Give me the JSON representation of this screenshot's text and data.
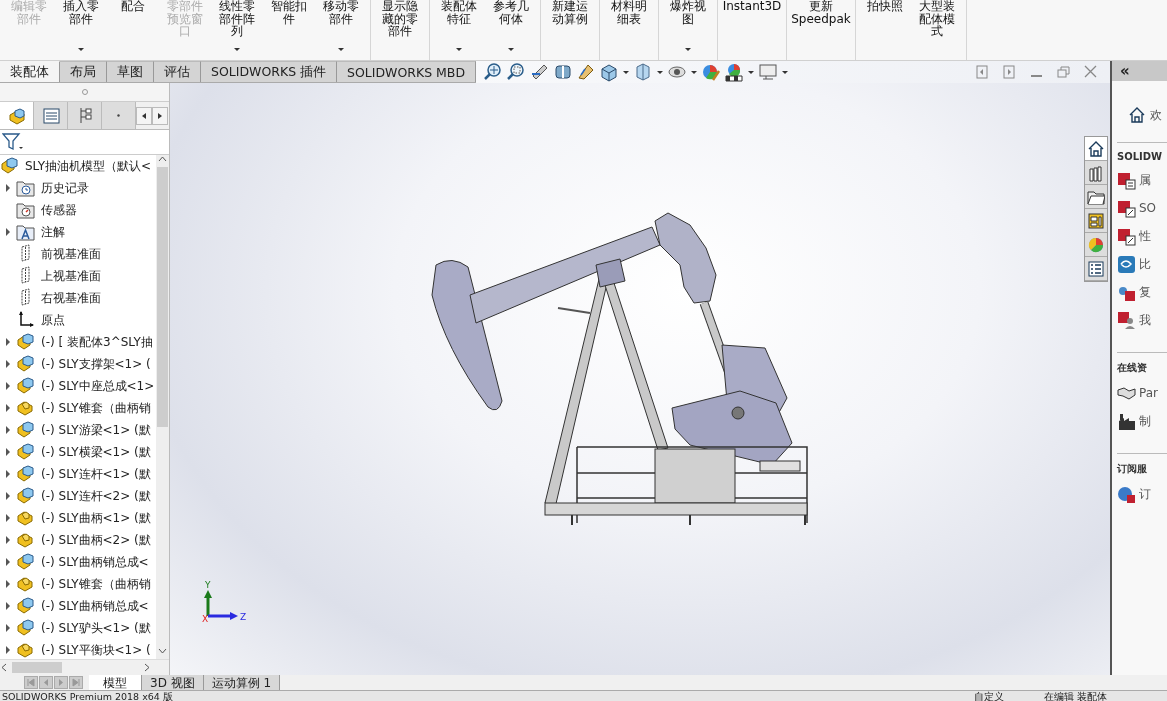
{
  "ribbon": {
    "groups": [
      [
        {
          "label": "编辑零部件",
          "disabled": true,
          "dropdown": false
        },
        {
          "label": "插入零部件",
          "disabled": false,
          "dropdown": true
        },
        {
          "label": "配合",
          "disabled": false,
          "dropdown": false
        },
        {
          "label": "零部件预览窗口",
          "disabled": true,
          "dropdown": false
        },
        {
          "label": "线性零部件阵列",
          "disabled": false,
          "dropdown": true
        },
        {
          "label": "智能扣件",
          "disabled": false,
          "dropdown": false
        },
        {
          "label": "移动零部件",
          "disabled": false,
          "dropdown": true
        }
      ],
      [
        {
          "label": "显示隐藏的零部件",
          "disabled": false,
          "dropdown": false
        }
      ],
      [
        {
          "label": "装配体特征",
          "disabled": false,
          "dropdown": true
        },
        {
          "label": "参考几何体",
          "disabled": false,
          "dropdown": true
        }
      ],
      [
        {
          "label": "新建运动算例",
          "disabled": false,
          "dropdown": false
        }
      ],
      [
        {
          "label": "材料明细表",
          "disabled": false,
          "dropdown": false
        }
      ],
      [
        {
          "label": "爆炸视图",
          "disabled": false,
          "dropdown": true
        }
      ],
      [
        {
          "label": "Instant3D",
          "disabled": false,
          "dropdown": false
        }
      ],
      [
        {
          "label": "更新Speedpak",
          "disabled": false,
          "dropdown": false
        }
      ],
      [
        {
          "label": "拍快照",
          "disabled": false,
          "dropdown": false
        },
        {
          "label": "大型装配体模式",
          "disabled": false,
          "dropdown": false
        }
      ]
    ]
  },
  "command_tabs": [
    {
      "label": "装配体",
      "selected": true
    },
    {
      "label": "布局",
      "selected": false
    },
    {
      "label": "草图",
      "selected": false
    },
    {
      "label": "评估",
      "selected": false
    },
    {
      "label": "SOLIDWORKS 插件",
      "selected": false
    },
    {
      "label": "SOLIDWORKS MBD",
      "selected": false
    }
  ],
  "feature_tree": {
    "panel_tabs": [
      {
        "kind": "feature",
        "selected": true
      },
      {
        "kind": "property",
        "selected": false
      },
      {
        "kind": "config",
        "selected": false
      },
      {
        "kind": "more",
        "selected": false
      }
    ],
    "root": {
      "label": "SLY抽油机模型（默认<",
      "kind": "assembly",
      "expanded": true,
      "children": [
        {
          "label": "历史记录",
          "kind": "history",
          "expanded": false
        },
        {
          "label": "传感器",
          "kind": "sensor"
        },
        {
          "label": "注解",
          "kind": "annotation",
          "expanded": false
        },
        {
          "label": "前视基准面",
          "kind": "plane"
        },
        {
          "label": "上视基准面",
          "kind": "plane"
        },
        {
          "label": "右视基准面",
          "kind": "plane"
        },
        {
          "label": "原点",
          "kind": "origin"
        },
        {
          "label": "(-) [ 装配体3^SLY抽",
          "kind": "assembly",
          "expanded": false
        },
        {
          "label": "(-) SLY支撑架<1> (",
          "kind": "assembly",
          "expanded": false
        },
        {
          "label": "(-) SLY中座总成<1>",
          "kind": "assembly",
          "expanded": false
        },
        {
          "label": "(-) SLY锥套（曲柄销",
          "kind": "part",
          "expanded": false
        },
        {
          "label": "(-) SLY游梁<1> (默",
          "kind": "assembly",
          "expanded": false
        },
        {
          "label": "(-) SLY横梁<1> (默",
          "kind": "assembly",
          "expanded": false
        },
        {
          "label": "(-) SLY连杆<1> (默",
          "kind": "assembly",
          "expanded": false
        },
        {
          "label": "(-) SLY连杆<2> (默",
          "kind": "assembly",
          "expanded": false
        },
        {
          "label": "(-) SLY曲柄<1> (默",
          "kind": "part",
          "expanded": false
        },
        {
          "label": "(-) SLY曲柄<2> (默",
          "kind": "part",
          "expanded": false
        },
        {
          "label": "(-) SLY曲柄销总成<",
          "kind": "assembly",
          "expanded": false
        },
        {
          "label": "(-) SLY锥套（曲柄销",
          "kind": "part",
          "expanded": false
        },
        {
          "label": "(-) SLY曲柄销总成<",
          "kind": "assembly",
          "expanded": false
        },
        {
          "label": "(-) SLY驴头<1> (默",
          "kind": "assembly",
          "expanded": false
        },
        {
          "label": "(-) SLY平衡块<1> (",
          "kind": "part",
          "expanded": false
        }
      ]
    }
  },
  "viewport": {
    "triad": {
      "x": "X",
      "y": "Y",
      "z": "Z"
    }
  },
  "task_pane": {
    "collapse": "«",
    "tabs": [
      {
        "kind": "home",
        "selected": true
      },
      {
        "kind": "library",
        "selected": false
      },
      {
        "kind": "folder",
        "selected": false
      },
      {
        "kind": "palette",
        "selected": false
      },
      {
        "kind": "appearance",
        "selected": false
      },
      {
        "kind": "properties",
        "selected": false
      }
    ],
    "welcome": "欢",
    "sections": [
      {
        "title": "SOLIDW",
        "items": [
          {
            "label": "属",
            "kind": "sw-doc"
          },
          {
            "label": "SO",
            "kind": "sw-fx"
          },
          {
            "label": "性",
            "kind": "sw-fx"
          },
          {
            "label": "比",
            "kind": "compare"
          },
          {
            "label": "复",
            "kind": "sw-copy"
          },
          {
            "label": "我",
            "kind": "sw-user"
          }
        ]
      },
      {
        "title": "在线资",
        "items": [
          {
            "label": "Par",
            "kind": "handshake"
          },
          {
            "label": "制",
            "kind": "factory"
          }
        ]
      },
      {
        "title": "订阅服",
        "items": [
          {
            "label": "订",
            "kind": "globe"
          }
        ]
      }
    ]
  },
  "bottom_tabs": [
    {
      "label": "模型",
      "selected": true
    },
    {
      "label": "3D 视图",
      "selected": false
    },
    {
      "label": "运动算例 1",
      "selected": false
    }
  ],
  "status_bar": [
    "SOLIDWORKS Premium 2018 x64 版",
    "自定义",
    "在编辑 装配体"
  ]
}
